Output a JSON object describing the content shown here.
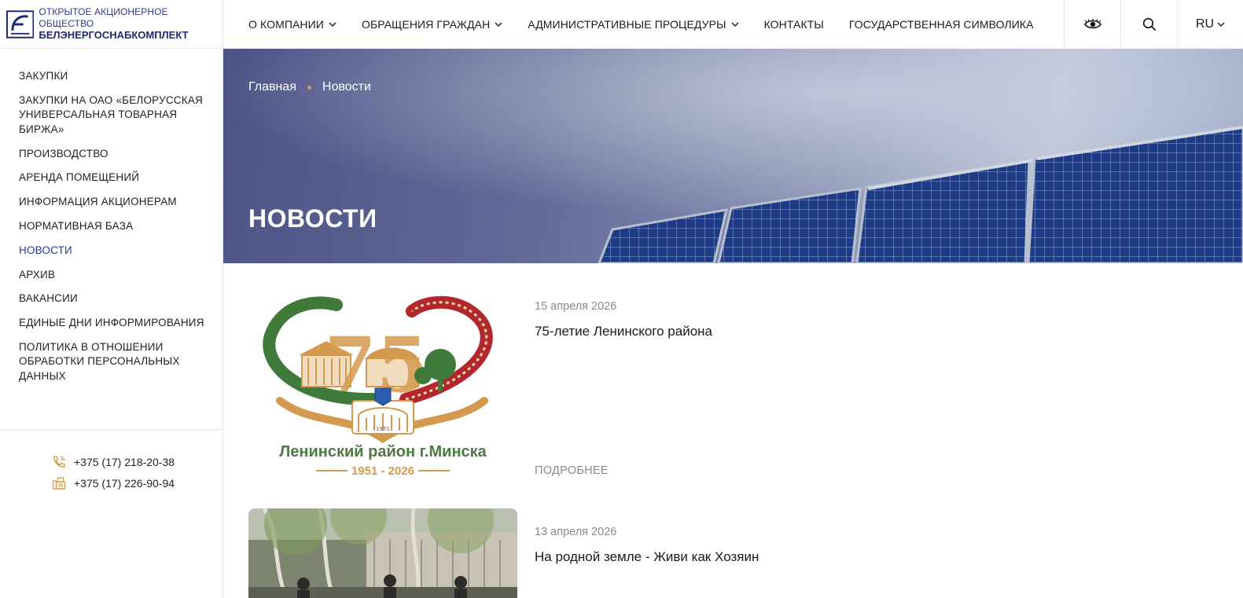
{
  "header": {
    "logo_line1": "ОТКРЫТОЕ АКЦИОНЕРНОЕ ОБЩЕСТВО",
    "logo_line2": "БЕЛЭНЕРГОСНАБКОМПЛЕКТ",
    "nav": [
      {
        "label": "О КОМПАНИИ",
        "dropdown": true
      },
      {
        "label": "ОБРАЩЕНИЯ ГРАЖДАН",
        "dropdown": true
      },
      {
        "label": "АДМИНИСТРАТИВНЫЕ ПРОЦЕДУРЫ",
        "dropdown": true
      },
      {
        "label": "КОНТАКТЫ",
        "dropdown": false
      },
      {
        "label": "ГОСУДАРСТВЕННАЯ СИМВОЛИКА",
        "dropdown": false
      }
    ],
    "lang": "RU",
    "icons": [
      "eye-icon",
      "search-icon"
    ]
  },
  "sidebar": {
    "items": [
      {
        "label": "ЗАКУПКИ"
      },
      {
        "label": "ЗАКУПКИ НА ОАО «БЕЛОРУССКАЯ УНИВЕРСАЛЬНАЯ ТОВАРНАЯ БИРЖА»"
      },
      {
        "label": "ПРОИЗВОДСТВО"
      },
      {
        "label": "АРЕНДА ПОМЕЩЕНИЙ"
      },
      {
        "label": "ИНФОРМАЦИЯ АКЦИОНЕРАМ"
      },
      {
        "label": "НОРМАТИВНАЯ БАЗА"
      },
      {
        "label": "НОВОСТИ",
        "active": true
      },
      {
        "label": "АРХИВ"
      },
      {
        "label": "ВАКАНСИИ"
      },
      {
        "label": "ЕДИНЫЕ ДНИ ИНФОРМИРОВАНИЯ"
      },
      {
        "label": "ПОЛИТИКА В ОТНОШЕНИИ ОБРАБОТКИ ПЕРСОНАЛЬНЫХ ДАННЫХ"
      }
    ],
    "phone": "+375 (17) 218-20-38",
    "fax": "+375 (17) 226-90-94"
  },
  "hero": {
    "breadcrumb_home": "Главная",
    "breadcrumb_current": "Новости",
    "title": "НОВОСТИ"
  },
  "news": [
    {
      "date": "15 апреля 2026",
      "title": "75-летие Ленинского района",
      "more": "ПОДРОБНЕЕ",
      "logo_caption": "Ленинский район г.Минска",
      "logo_years": "1951 - 2026",
      "logo_number": "75",
      "logo_badge_year": "1951"
    },
    {
      "date": "13 апреля 2026",
      "title": "На родной земле - Живи как Хозяин"
    }
  ],
  "colors": {
    "accent": "#2a3a8c",
    "gold": "#d4a04a",
    "logo_green": "#3f7a3a",
    "logo_red": "#b3262c",
    "logo_gold": "#d39a4f"
  }
}
